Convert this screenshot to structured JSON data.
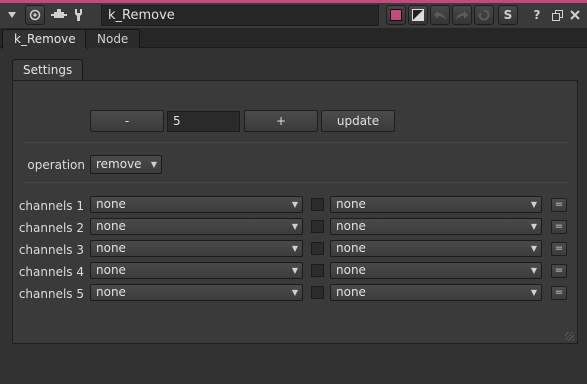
{
  "titlebar": {
    "node_name": "k_Remove",
    "help_label": "?",
    "s_label": "S",
    "accent_color": "#c34a7c",
    "node_color_swatch": "#c34a7c"
  },
  "tabs": [
    {
      "label": "k_Remove",
      "active": true
    },
    {
      "label": "Node",
      "active": false
    }
  ],
  "panel": {
    "subtab_label": "Settings",
    "count": {
      "minus_label": "-",
      "value": "5",
      "plus_label": "+",
      "update_label": "update"
    },
    "operation": {
      "label": "operation",
      "value": "remove"
    },
    "channels": [
      {
        "label": "channels 1",
        "left": "none",
        "right": "none",
        "eq": "="
      },
      {
        "label": "channels 2",
        "left": "none",
        "right": "none",
        "eq": "="
      },
      {
        "label": "channels 3",
        "left": "none",
        "right": "none",
        "eq": "="
      },
      {
        "label": "channels 4",
        "left": "none",
        "right": "none",
        "eq": "="
      },
      {
        "label": "channels 5",
        "left": "none",
        "right": "none",
        "eq": "="
      }
    ]
  }
}
